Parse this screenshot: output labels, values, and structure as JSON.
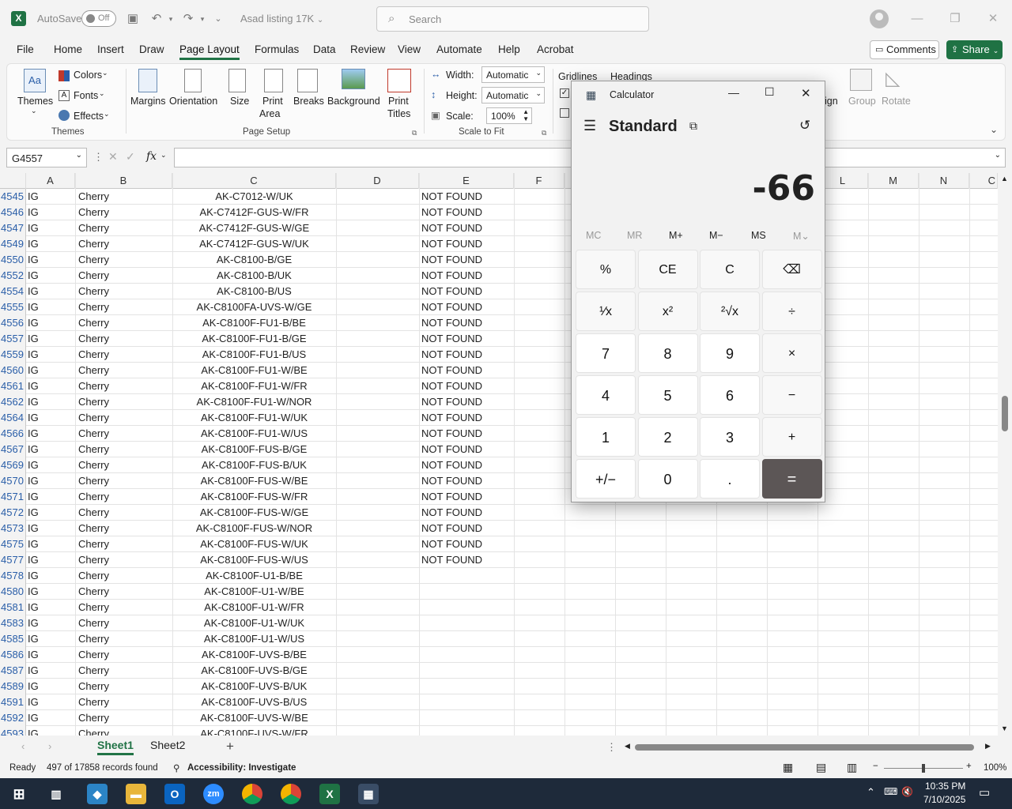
{
  "titlebar": {
    "autosave_label": "AutoSave",
    "autosave_state": "Off",
    "file_name": "Asad listing 17K",
    "search_placeholder": "Search"
  },
  "menu": [
    "File",
    "Home",
    "Insert",
    "Draw",
    "Page Layout",
    "Formulas",
    "Data",
    "Review",
    "View",
    "Automate",
    "Help",
    "Acrobat"
  ],
  "active_menu": "Page Layout",
  "comments_label": "Comments",
  "share_label": "Share",
  "ribbon": {
    "themes": "Themes",
    "colors": "Colors",
    "fonts": "Fonts",
    "effects": "Effects",
    "themes_group": "Themes",
    "margins": "Margins",
    "orientation": "Orientation",
    "size": "Size",
    "print_area": "Print",
    "print_area2": "Area",
    "breaks": "Breaks",
    "background": "Background",
    "print_titles": "Print",
    "print_titles2": "Titles",
    "page_setup_group": "Page Setup",
    "width_label": "Width:",
    "width_value": "Automatic",
    "height_label": "Height:",
    "height_value": "Automatic",
    "scale_label": "Scale:",
    "scale_value": "100%",
    "scale_group": "Scale to Fit",
    "gridlines": "Gridlines",
    "headings": "Headings",
    "align_partial": "ign",
    "group": "Group",
    "rotate": "Rotate"
  },
  "formula_bar": {
    "name_box": "G4557",
    "fx": "fx",
    "value": ""
  },
  "columns": [
    "A",
    "B",
    "C",
    "D",
    "E",
    "F",
    "L",
    "M",
    "N",
    "C"
  ],
  "rows": [
    {
      "n": "4545",
      "a": "IG",
      "b": "Cherry",
      "c": "AK-C7012-W/UK",
      "e": "NOT FOUND"
    },
    {
      "n": "4546",
      "a": "IG",
      "b": "Cherry",
      "c": "AK-C7412F-GUS-W/FR",
      "e": "NOT FOUND"
    },
    {
      "n": "4547",
      "a": "IG",
      "b": "Cherry",
      "c": "AK-C7412F-GUS-W/GE",
      "e": "NOT FOUND"
    },
    {
      "n": "4549",
      "a": "IG",
      "b": "Cherry",
      "c": "AK-C7412F-GUS-W/UK",
      "e": "NOT FOUND"
    },
    {
      "n": "4550",
      "a": "IG",
      "b": "Cherry",
      "c": "AK-C8100-B/GE",
      "e": "NOT FOUND"
    },
    {
      "n": "4552",
      "a": "IG",
      "b": "Cherry",
      "c": "AK-C8100-B/UK",
      "e": "NOT FOUND"
    },
    {
      "n": "4554",
      "a": "IG",
      "b": "Cherry",
      "c": "AK-C8100-B/US",
      "e": "NOT FOUND"
    },
    {
      "n": "4555",
      "a": "IG",
      "b": "Cherry",
      "c": "AK-C8100FA-UVS-W/GE",
      "e": "NOT FOUND"
    },
    {
      "n": "4556",
      "a": "IG",
      "b": "Cherry",
      "c": "AK-C8100F-FU1-B/BE",
      "e": "NOT FOUND"
    },
    {
      "n": "4557",
      "a": "IG",
      "b": "Cherry",
      "c": "AK-C8100F-FU1-B/GE",
      "e": "NOT FOUND"
    },
    {
      "n": "4559",
      "a": "IG",
      "b": "Cherry",
      "c": "AK-C8100F-FU1-B/US",
      "e": "NOT FOUND"
    },
    {
      "n": "4560",
      "a": "IG",
      "b": "Cherry",
      "c": "AK-C8100F-FU1-W/BE",
      "e": "NOT FOUND"
    },
    {
      "n": "4561",
      "a": "IG",
      "b": "Cherry",
      "c": "AK-C8100F-FU1-W/FR",
      "e": "NOT FOUND"
    },
    {
      "n": "4562",
      "a": "IG",
      "b": "Cherry",
      "c": "AK-C8100F-FU1-W/NOR",
      "e": "NOT FOUND"
    },
    {
      "n": "4564",
      "a": "IG",
      "b": "Cherry",
      "c": "AK-C8100F-FU1-W/UK",
      "e": "NOT FOUND"
    },
    {
      "n": "4566",
      "a": "IG",
      "b": "Cherry",
      "c": "AK-C8100F-FU1-W/US",
      "e": "NOT FOUND"
    },
    {
      "n": "4567",
      "a": "IG",
      "b": "Cherry",
      "c": "AK-C8100F-FUS-B/GE",
      "e": "NOT FOUND"
    },
    {
      "n": "4569",
      "a": "IG",
      "b": "Cherry",
      "c": "AK-C8100F-FUS-B/UK",
      "e": "NOT FOUND"
    },
    {
      "n": "4570",
      "a": "IG",
      "b": "Cherry",
      "c": "AK-C8100F-FUS-W/BE",
      "e": "NOT FOUND"
    },
    {
      "n": "4571",
      "a": "IG",
      "b": "Cherry",
      "c": "AK-C8100F-FUS-W/FR",
      "e": "NOT FOUND"
    },
    {
      "n": "4572",
      "a": "IG",
      "b": "Cherry",
      "c": "AK-C8100F-FUS-W/GE",
      "e": "NOT FOUND"
    },
    {
      "n": "4573",
      "a": "IG",
      "b": "Cherry",
      "c": "AK-C8100F-FUS-W/NOR",
      "e": "NOT FOUND"
    },
    {
      "n": "4575",
      "a": "IG",
      "b": "Cherry",
      "c": "AK-C8100F-FUS-W/UK",
      "e": "NOT FOUND"
    },
    {
      "n": "4577",
      "a": "IG",
      "b": "Cherry",
      "c": "AK-C8100F-FUS-W/US",
      "e": "NOT FOUND"
    },
    {
      "n": "4578",
      "a": "IG",
      "b": "Cherry",
      "c": "AK-C8100F-U1-B/BE",
      "e": ""
    },
    {
      "n": "4580",
      "a": "IG",
      "b": "Cherry",
      "c": "AK-C8100F-U1-W/BE",
      "e": ""
    },
    {
      "n": "4581",
      "a": "IG",
      "b": "Cherry",
      "c": "AK-C8100F-U1-W/FR",
      "e": ""
    },
    {
      "n": "4583",
      "a": "IG",
      "b": "Cherry",
      "c": "AK-C8100F-U1-W/UK",
      "e": ""
    },
    {
      "n": "4585",
      "a": "IG",
      "b": "Cherry",
      "c": "AK-C8100F-U1-W/US",
      "e": ""
    },
    {
      "n": "4586",
      "a": "IG",
      "b": "Cherry",
      "c": "AK-C8100F-UVS-B/BE",
      "e": ""
    },
    {
      "n": "4587",
      "a": "IG",
      "b": "Cherry",
      "c": "AK-C8100F-UVS-B/GE",
      "e": ""
    },
    {
      "n": "4589",
      "a": "IG",
      "b": "Cherry",
      "c": "AK-C8100F-UVS-B/UK",
      "e": ""
    },
    {
      "n": "4591",
      "a": "IG",
      "b": "Cherry",
      "c": "AK-C8100F-UVS-B/US",
      "e": ""
    },
    {
      "n": "4592",
      "a": "IG",
      "b": "Cherry",
      "c": "AK-C8100F-UVS-W/BE",
      "e": ""
    },
    {
      "n": "4593",
      "a": "IG",
      "b": "Cherry",
      "c": "AK-C8100F-UVS-W/FR",
      "e": ""
    }
  ],
  "sheets": [
    "Sheet1",
    "Sheet2"
  ],
  "active_sheet": "Sheet1",
  "status": {
    "ready": "Ready",
    "records": "497 of 17858 records found",
    "accessibility": "Accessibility: Investigate",
    "zoom": "100%"
  },
  "calculator": {
    "title": "Calculator",
    "mode": "Standard",
    "display": "-66",
    "memory": [
      "MC",
      "MR",
      "M+",
      "M−",
      "MS",
      "M⌄"
    ],
    "keys": [
      [
        "%",
        "CE",
        "C",
        "⌫"
      ],
      [
        "¹⁄x",
        "x²",
        "²√x",
        "÷"
      ],
      [
        "7",
        "8",
        "9",
        "×"
      ],
      [
        "4",
        "5",
        "6",
        "−"
      ],
      [
        "1",
        "2",
        "3",
        "+"
      ],
      [
        "+/−",
        "0",
        ".",
        "="
      ]
    ]
  },
  "taskbar": {
    "time": "10:35 PM",
    "date": "7/10/2025"
  },
  "colors": {
    "excel_green": "#217346",
    "share_green": "#1f7244",
    "row_number_blue": "#2a5ea8",
    "calc_equals": "#5c5656",
    "taskbar": "#1e2a3a"
  }
}
